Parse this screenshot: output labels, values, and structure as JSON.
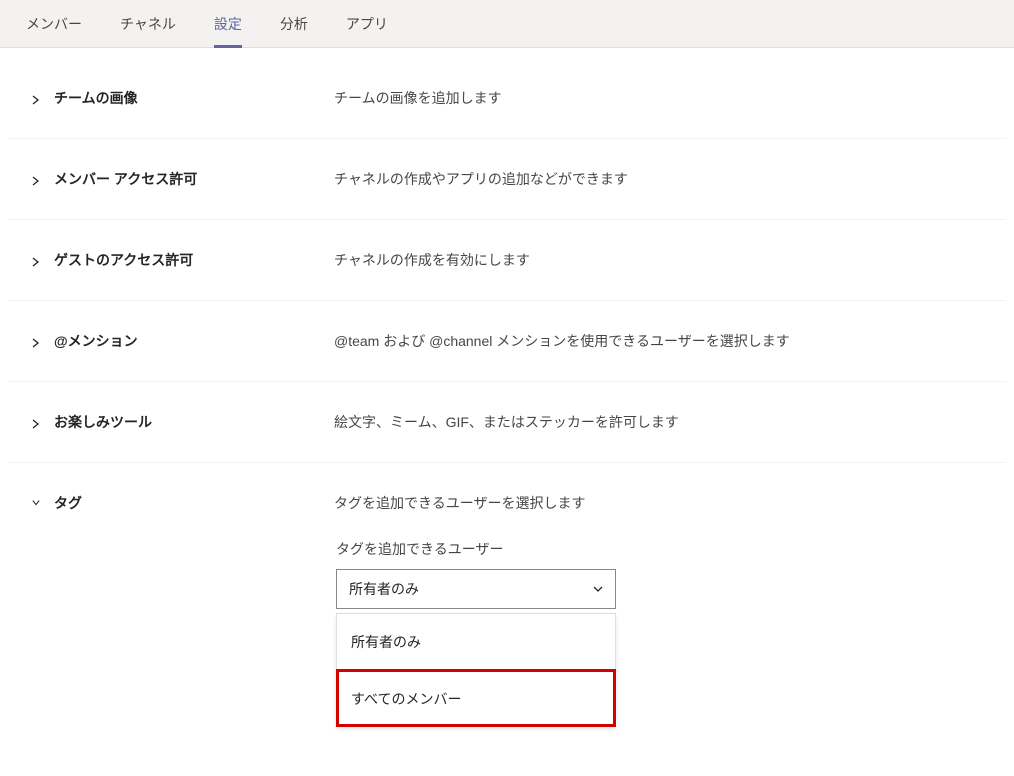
{
  "tabs": {
    "members": "メンバー",
    "channels": "チャネル",
    "settings": "設定",
    "analytics": "分析",
    "apps": "アプリ"
  },
  "sections": {
    "teamImage": {
      "label": "チームの画像",
      "desc": "チームの画像を追加します"
    },
    "memberPerms": {
      "label": "メンバー アクセス許可",
      "desc": "チャネルの作成やアプリの追加などができます"
    },
    "guestPerms": {
      "label": "ゲストのアクセス許可",
      "desc": "チャネルの作成を有効にします"
    },
    "mentions": {
      "label": "@メンション",
      "desc": "@team および @channel メンションを使用できるユーザーを選択します"
    },
    "funStuff": {
      "label": "お楽しみツール",
      "desc": "絵文字、ミーム、GIF、またはステッカーを許可します"
    },
    "tags": {
      "label": "タグ",
      "desc": "タグを追加できるユーザーを選択します",
      "fieldLabel": "タグを追加できるユーザー",
      "selected": "所有者のみ",
      "options": {
        "ownersOnly": "所有者のみ",
        "allMembers": "すべてのメンバー"
      }
    }
  }
}
